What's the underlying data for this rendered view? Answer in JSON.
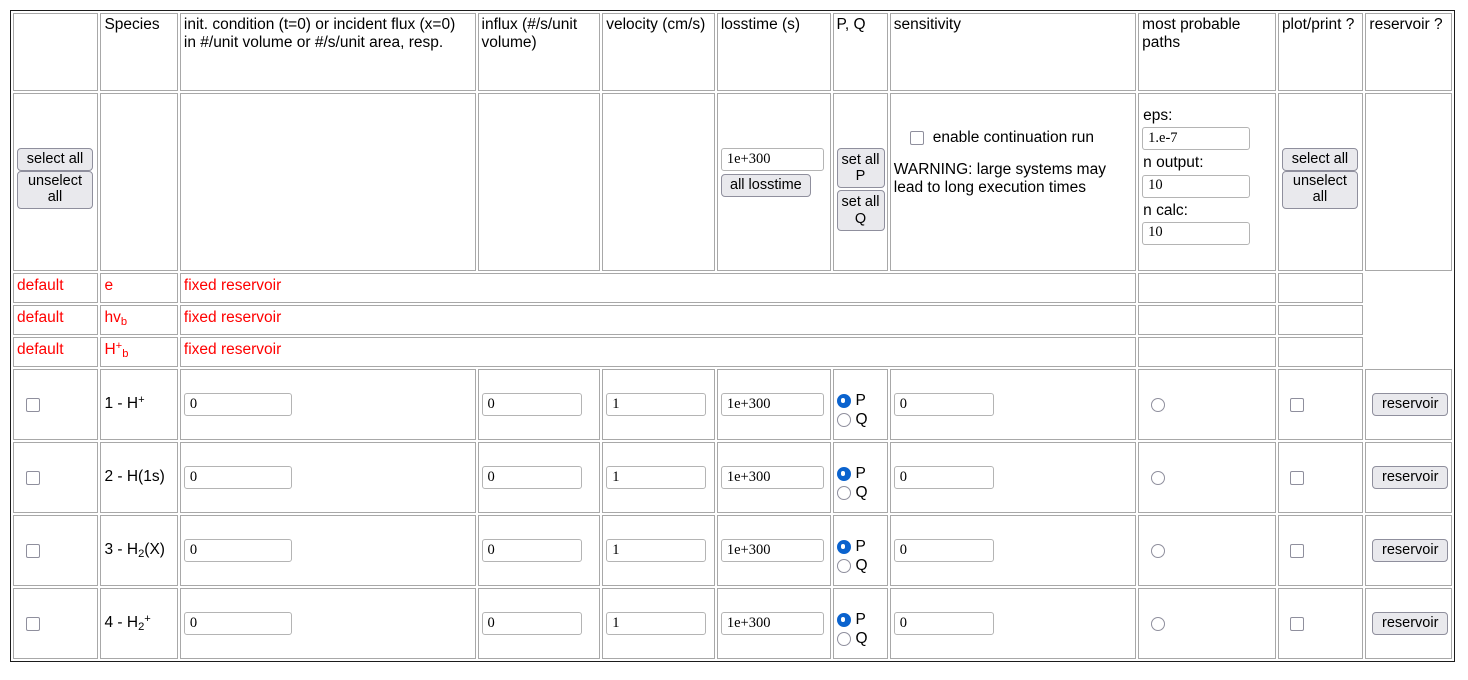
{
  "table": {
    "headers": [
      {
        "label": "",
        "name": "select-column"
      },
      {
        "label": "Species",
        "name": "species-column"
      },
      {
        "label": "init. condition (t=0) or incident flux (x=0) in #/unit volume or #/s/unit area, resp.",
        "name": "init-condition-column"
      },
      {
        "label": "influx (#/s/unit volume)",
        "name": "influx-column"
      },
      {
        "label": "velocity (cm/s)",
        "name": "velocity-column"
      },
      {
        "label": "losstime (s)",
        "name": "losstime-column"
      },
      {
        "label": "P, Q",
        "name": "pq-column"
      },
      {
        "label": "sensitivity",
        "name": "sensitivity-column"
      },
      {
        "label": "most probable paths",
        "name": "most-probable-paths-column"
      },
      {
        "label": "plot/print ?",
        "name": "plot-print-column"
      },
      {
        "label": "reservoir ?",
        "name": "reservoir-column"
      }
    ]
  },
  "bulk": {
    "select_all": "select all",
    "unselect_all": "unselect all",
    "losstime_value": "1e+300",
    "all_losstime": "all losstime",
    "set_all_p": "set all P",
    "set_all_q": "set all Q",
    "enable_continuation": "enable continuation run",
    "continuation_checked": false,
    "warning": "WARNING: large systems may lead to long execution times",
    "eps_label": "eps:",
    "eps_value": "1.e-7",
    "noutput_label": "n output:",
    "noutput_value": "10",
    "ncalc_label": "n calc:",
    "ncalc_value": "10",
    "plot_select_all": "select all",
    "plot_unselect_all": "unselect all"
  },
  "default_rows": [
    {
      "flag": "default",
      "species_html": "e",
      "note": "fixed reservoir"
    },
    {
      "flag": "default",
      "species_html": "hv<sub>b</sub>",
      "note": "fixed reservoir"
    },
    {
      "flag": "default",
      "species_html": "H<sup>+</sup><sub>b</sub>",
      "note": "fixed reservoir"
    }
  ],
  "species_rows": [
    {
      "selected": false,
      "species_html": "1 - H<sup>+</sup>",
      "init_condition": "0",
      "influx": "0",
      "velocity": "1",
      "losstime": "1e+300",
      "pq": "P",
      "p_label": "P",
      "q_label": "Q",
      "sensitivity": "0",
      "mpp_selected": false,
      "plot_print": false,
      "reservoir_label": "reservoir"
    },
    {
      "selected": false,
      "species_html": "2 - H(1s)",
      "init_condition": "0",
      "influx": "0",
      "velocity": "1",
      "losstime": "1e+300",
      "pq": "P",
      "p_label": "P",
      "q_label": "Q",
      "sensitivity": "0",
      "mpp_selected": false,
      "plot_print": false,
      "reservoir_label": "reservoir"
    },
    {
      "selected": false,
      "species_html": "3 - H<sub>2</sub>(X)",
      "init_condition": "0",
      "influx": "0",
      "velocity": "1",
      "losstime": "1e+300",
      "pq": "P",
      "p_label": "P",
      "q_label": "Q",
      "sensitivity": "0",
      "mpp_selected": false,
      "plot_print": false,
      "reservoir_label": "reservoir"
    },
    {
      "selected": false,
      "species_html": "4 - H<sub>2</sub><sup>+</sup>",
      "init_condition": "0",
      "influx": "0",
      "velocity": "1",
      "losstime": "1e+300",
      "pq": "P",
      "p_label": "P",
      "q_label": "Q",
      "sensitivity": "0",
      "mpp_selected": false,
      "plot_print": false,
      "reservoir_label": "reservoir"
    }
  ],
  "colors": {
    "default_row_text": "#ff0000",
    "radio_selected": "#0b63ce",
    "button_face": "#e9e9ed",
    "cell_border": "#a8a8a8",
    "table_border": "#1b1b1b"
  }
}
